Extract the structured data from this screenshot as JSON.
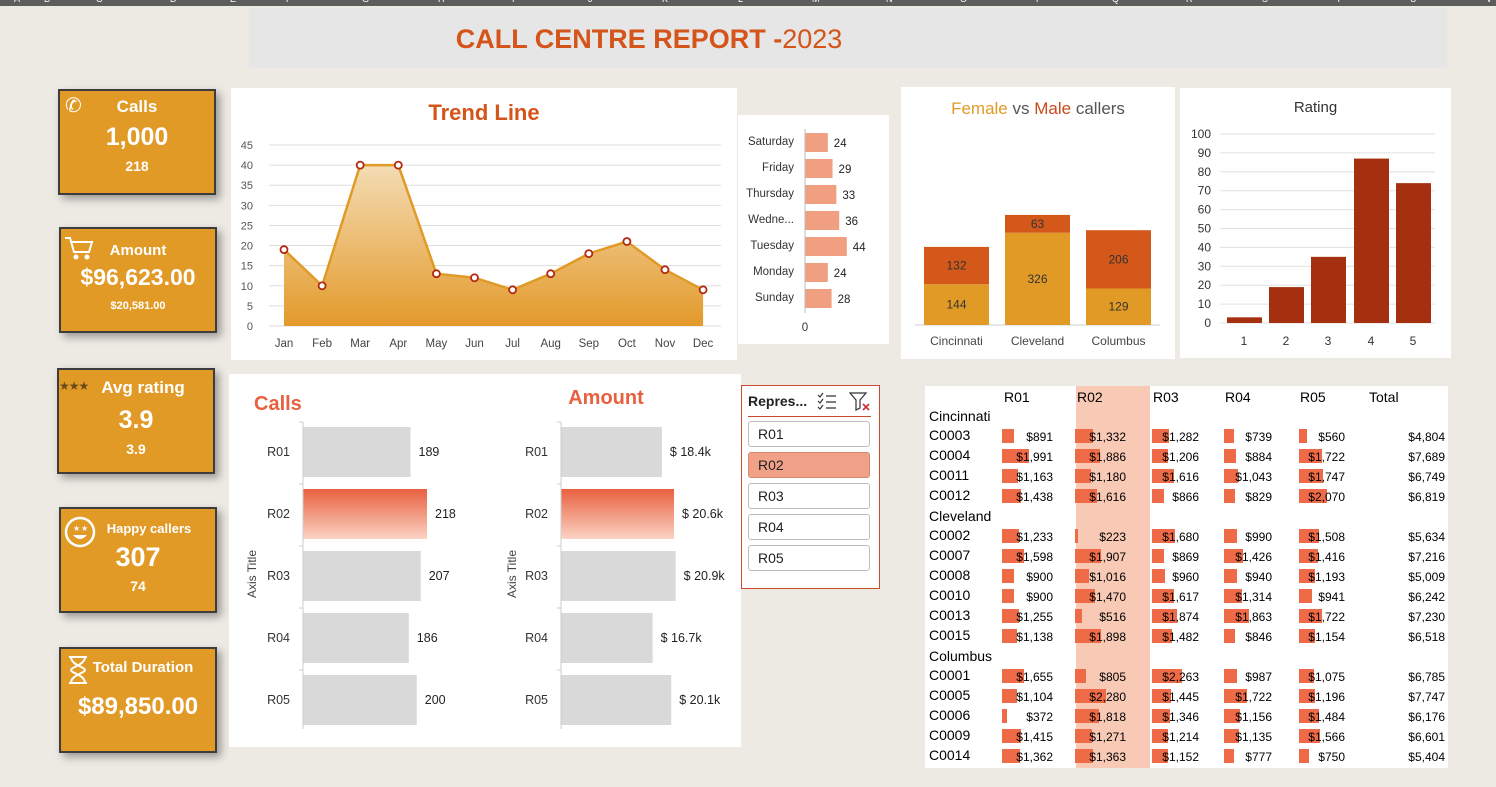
{
  "sheet": {
    "column_letters": [
      "A",
      "B",
      "C",
      "D",
      "E",
      "F",
      "G",
      "H",
      "I",
      "J",
      "K",
      "L",
      "M",
      "N",
      "O",
      "P",
      "Q",
      "R",
      "S",
      "T",
      "U",
      "V"
    ]
  },
  "report": {
    "title_main": "CALL CENTRE REPORT -",
    "title_year": "2023"
  },
  "kpis": {
    "calls": {
      "label": "Calls",
      "value": "1,000",
      "sub": "218",
      "icon": "phone-icon"
    },
    "amount": {
      "label": "Amount",
      "value": "$96,623.00",
      "sub": "$20,581.00",
      "icon": "cart-icon"
    },
    "avg_rating": {
      "label": "Avg rating",
      "value": "3.9",
      "sub": "3.9",
      "icon": "stars-icon"
    },
    "happy": {
      "label": "Happy callers",
      "value": "307",
      "sub": "74",
      "icon": "smiley-icon"
    },
    "duration": {
      "label": "Total Duration",
      "value": "$89,850.00",
      "icon": "hourglass-icon"
    }
  },
  "colors": {
    "accent": "#e19a26",
    "title": "#d4541a",
    "dark_red": "#a4300f",
    "orange_red": "#d4581a",
    "salmon": "#ef6b47",
    "selected": "#f0a187"
  },
  "trend_chart": {
    "chart_data": {
      "type": "area",
      "title": "Trend Line",
      "categories": [
        "Jan",
        "Feb",
        "Mar",
        "Apr",
        "May",
        "Jun",
        "Jul",
        "Aug",
        "Sep",
        "Oct",
        "Nov",
        "Dec"
      ],
      "values": [
        19,
        10,
        40,
        40,
        13,
        12,
        9,
        13,
        18,
        21,
        14,
        9
      ],
      "ylim": [
        0,
        45
      ],
      "yticks": [
        "0",
        "5",
        "10",
        "15",
        "20",
        "25",
        "30",
        "35",
        "40",
        "45"
      ],
      "grid": true
    }
  },
  "weekday_chart": {
    "chart_data": {
      "type": "bar",
      "categories": [
        "Saturday",
        "Friday",
        "Thursday",
        "Wedne...",
        "Tuesday",
        "Monday",
        "Sunday"
      ],
      "values": [
        24,
        29,
        33,
        36,
        44,
        24,
        28
      ],
      "xticks": [
        "0",
        "100"
      ],
      "xlim": [
        0,
        100
      ]
    }
  },
  "gender_chart": {
    "title_female": "Female",
    "title_vs": "vs",
    "title_male": "Male",
    "title_rest": "callers",
    "chart_data": {
      "type": "bar",
      "stacked": true,
      "categories": [
        "Cincinnati",
        "Cleveland",
        "Columbus"
      ],
      "series": [
        {
          "values": [
            144,
            326,
            129
          ],
          "color": "#e19a26"
        },
        {
          "values": [
            132,
            63,
            206
          ],
          "color": "#d4581a"
        }
      ]
    }
  },
  "rating_chart": {
    "chart_data": {
      "type": "bar",
      "title": "Rating",
      "categories": [
        "1",
        "2",
        "3",
        "4",
        "5"
      ],
      "values": [
        3,
        19,
        35,
        87,
        74
      ],
      "ylim": [
        0,
        100
      ],
      "yticks": [
        "0",
        "10",
        "20",
        "30",
        "40",
        "50",
        "60",
        "70",
        "80",
        "90",
        "100"
      ]
    }
  },
  "calls_chart": {
    "chart_data": {
      "type": "bar",
      "title": "Calls",
      "ylabel": "Axis Title",
      "categories": [
        "R01",
        "R02",
        "R03",
        "R04",
        "R05"
      ],
      "values": [
        189,
        218,
        207,
        186,
        200
      ],
      "labels": [
        "189",
        "218",
        "207",
        "186",
        "200"
      ],
      "highlight": "R02"
    }
  },
  "amount_chart": {
    "chart_data": {
      "type": "bar",
      "title": "Amount",
      "ylabel": "Axis Title",
      "categories": [
        "R01",
        "R02",
        "R03",
        "R04",
        "R05"
      ],
      "values": [
        18.4,
        20.6,
        20.9,
        16.7,
        20.1
      ],
      "labels": [
        "$ 18.4k",
        "$ 20.6k",
        "$ 20.9k",
        "$ 16.7k",
        "$ 20.1k"
      ],
      "highlight": "R02"
    }
  },
  "slicer": {
    "header": "Repres...",
    "items": [
      "R01",
      "R02",
      "R03",
      "R04",
      "R05"
    ],
    "selected": "R02"
  },
  "table": {
    "headers": [
      "R01",
      "R02",
      "R03",
      "R04",
      "R05",
      "Total"
    ],
    "max_value": 2280,
    "groups": [
      {
        "name": "Cincinnati",
        "rows": [
          {
            "id": "C0003",
            "values": [
              891,
              1332,
              1282,
              739,
              560
            ],
            "labels": [
              "$891",
              "$1,332",
              "$1,282",
              "$739",
              "$560"
            ],
            "total": "$4,804"
          },
          {
            "id": "C0004",
            "values": [
              1991,
              1886,
              1206,
              884,
              1722
            ],
            "labels": [
              "$1,991",
              "$1,886",
              "$1,206",
              "$884",
              "$1,722"
            ],
            "total": "$7,689"
          },
          {
            "id": "C0011",
            "values": [
              1163,
              1180,
              1616,
              1043,
              1747
            ],
            "labels": [
              "$1,163",
              "$1,180",
              "$1,616",
              "$1,043",
              "$1,747"
            ],
            "total": "$6,749"
          },
          {
            "id": "C0012",
            "values": [
              1438,
              1616,
              866,
              829,
              2070
            ],
            "labels": [
              "$1,438",
              "$1,616",
              "$866",
              "$829",
              "$2,070"
            ],
            "total": "$6,819"
          }
        ]
      },
      {
        "name": "Cleveland",
        "rows": [
          {
            "id": "C0002",
            "values": [
              1233,
              223,
              1680,
              990,
              1508
            ],
            "labels": [
              "$1,233",
              "$223",
              "$1,680",
              "$990",
              "$1,508"
            ],
            "total": "$5,634"
          },
          {
            "id": "C0007",
            "values": [
              1598,
              1907,
              869,
              1426,
              1416
            ],
            "labels": [
              "$1,598",
              "$1,907",
              "$869",
              "$1,426",
              "$1,416"
            ],
            "total": "$7,216"
          },
          {
            "id": "C0008",
            "values": [
              900,
              1016,
              960,
              940,
              1193
            ],
            "labels": [
              "$900",
              "$1,016",
              "$960",
              "$940",
              "$1,193"
            ],
            "total": "$5,009"
          },
          {
            "id": "C0010",
            "values": [
              900,
              1470,
              1617,
              1314,
              941
            ],
            "labels": [
              "$900",
              "$1,470",
              "$1,617",
              "$1,314",
              "$941"
            ],
            "total": "$6,242"
          },
          {
            "id": "C0013",
            "values": [
              1255,
              516,
              1874,
              1863,
              1722
            ],
            "labels": [
              "$1,255",
              "$516",
              "$1,874",
              "$1,863",
              "$1,722"
            ],
            "total": "$7,230"
          },
          {
            "id": "C0015",
            "values": [
              1138,
              1898,
              1482,
              846,
              1154
            ],
            "labels": [
              "$1,138",
              "$1,898",
              "$1,482",
              "$846",
              "$1,154"
            ],
            "total": "$6,518"
          }
        ]
      },
      {
        "name": "Columbus",
        "rows": [
          {
            "id": "C0001",
            "values": [
              1655,
              805,
              2263,
              987,
              1075
            ],
            "labels": [
              "$1,655",
              "$805",
              "$2,263",
              "$987",
              "$1,075"
            ],
            "total": "$6,785"
          },
          {
            "id": "C0005",
            "values": [
              1104,
              2280,
              1445,
              1722,
              1196
            ],
            "labels": [
              "$1,104",
              "$2,280",
              "$1,445",
              "$1,722",
              "$1,196"
            ],
            "total": "$7,747"
          },
          {
            "id": "C0006",
            "values": [
              372,
              1818,
              1346,
              1156,
              1484
            ],
            "labels": [
              "$372",
              "$1,818",
              "$1,346",
              "$1,156",
              "$1,484"
            ],
            "total": "$6,176"
          },
          {
            "id": "C0009",
            "values": [
              1415,
              1271,
              1214,
              1135,
              1566
            ],
            "labels": [
              "$1,415",
              "$1,271",
              "$1,214",
              "$1,135",
              "$1,566"
            ],
            "total": "$6,601"
          },
          {
            "id": "C0014",
            "values": [
              1362,
              1363,
              1152,
              777,
              750
            ],
            "labels": [
              "$1,362",
              "$1,363",
              "$1,152",
              "$777",
              "$750"
            ],
            "total": "$5,404"
          }
        ]
      }
    ]
  }
}
